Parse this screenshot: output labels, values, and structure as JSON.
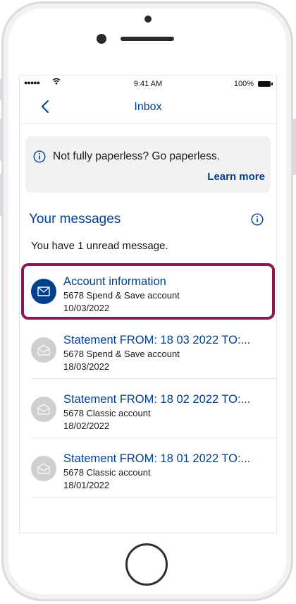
{
  "status_bar": {
    "signal": "●●●●●",
    "time": "9:41 AM",
    "battery": "100%"
  },
  "nav": {
    "title": "Inbox"
  },
  "banner": {
    "text": "Not fully paperless? Go paperless.",
    "link": "Learn more"
  },
  "section": {
    "title": "Your messages",
    "unread_text": "You have 1 unread message."
  },
  "messages": [
    {
      "title": "Account information",
      "account": "5678 Spend & Save account",
      "date": "10/03/2022",
      "unread": true
    },
    {
      "title": "Statement FROM: 18 03 2022 TO:...",
      "account": "5678 Spend & Save account",
      "date": "18/03/2022",
      "unread": false
    },
    {
      "title": "Statement FROM: 18 02 2022 TO:...",
      "account": "5678 Classic account",
      "date": "18/02/2022",
      "unread": false
    },
    {
      "title": "Statement FROM: 18 01 2022 TO:...",
      "account": "5678 Classic account",
      "date": "18/01/2022",
      "unread": false
    }
  ],
  "colors": {
    "brand_blue": "#00408f",
    "highlight": "#8a1a55",
    "read_icon_bg": "#cfcfcf"
  }
}
